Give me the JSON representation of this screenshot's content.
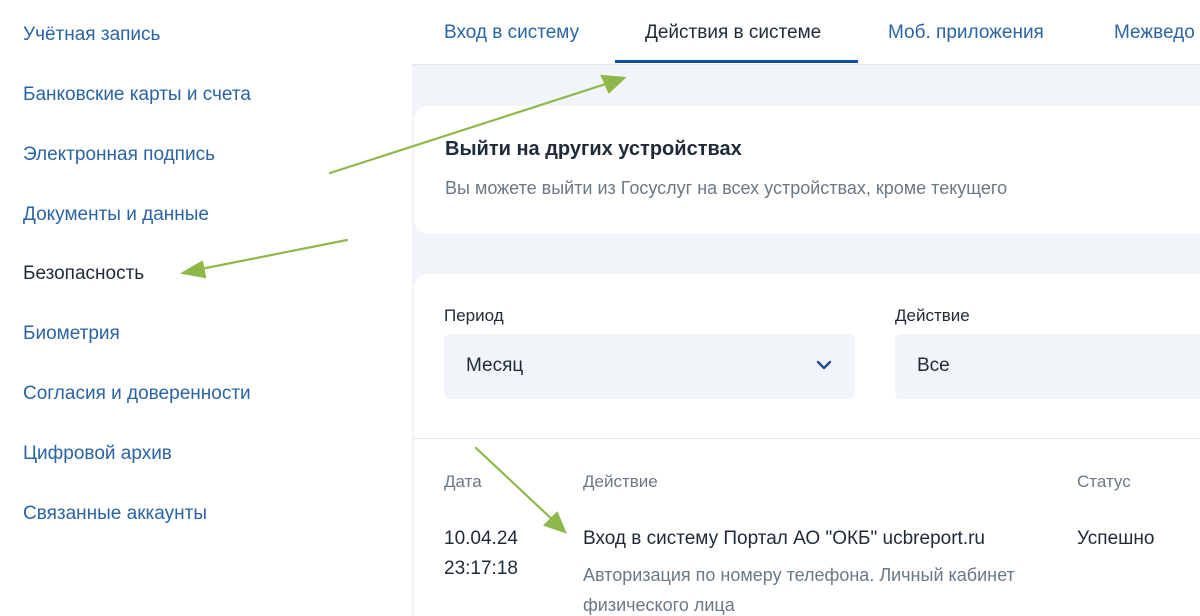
{
  "sidebar": {
    "items": [
      {
        "label": "Учётная запись"
      },
      {
        "label": "Банковские карты и счета"
      },
      {
        "label": "Электронная подпись"
      },
      {
        "label": "Документы и данные"
      },
      {
        "label": "Безопасность"
      },
      {
        "label": "Биометрия"
      },
      {
        "label": "Согласия и доверенности"
      },
      {
        "label": "Цифровой архив"
      },
      {
        "label": "Связанные аккаунты"
      }
    ],
    "active": "Безопасность"
  },
  "tabs": [
    {
      "label": "Вход в систему"
    },
    {
      "label": "Действия в системе"
    },
    {
      "label": "Моб. приложения"
    },
    {
      "label": "Межведо"
    }
  ],
  "active_tab": "Действия в системе",
  "logout_card": {
    "title": "Выйти на других устройствах",
    "subtitle": "Вы можете выйти из Госуслуг на всех устройствах, кроме текущего"
  },
  "filters": {
    "period_label": "Период",
    "period_value": "Месяц",
    "action_label": "Действие",
    "action_value": "Все"
  },
  "table": {
    "headers": {
      "date": "Дата",
      "action": "Действие",
      "status": "Статус"
    },
    "rows": [
      {
        "date": "10.04.24",
        "time": "23:17:18",
        "action": "Вход в систему Портал АО \"ОКБ\" ucbreport.ru",
        "details_line1": "Авторизация по номеру телефона. Личный кабинет",
        "details_line2": "физического лица",
        "status": "Успешно"
      }
    ]
  },
  "colors": {
    "link": "#2a64a4",
    "text": "#1f2a37",
    "muted": "#6b7885",
    "accent": "#0f4fa8",
    "background": "#f1f4f8",
    "annotation_arrow": "#8fb84a"
  },
  "icons": {
    "select_chevron": "chevron-down-icon"
  }
}
